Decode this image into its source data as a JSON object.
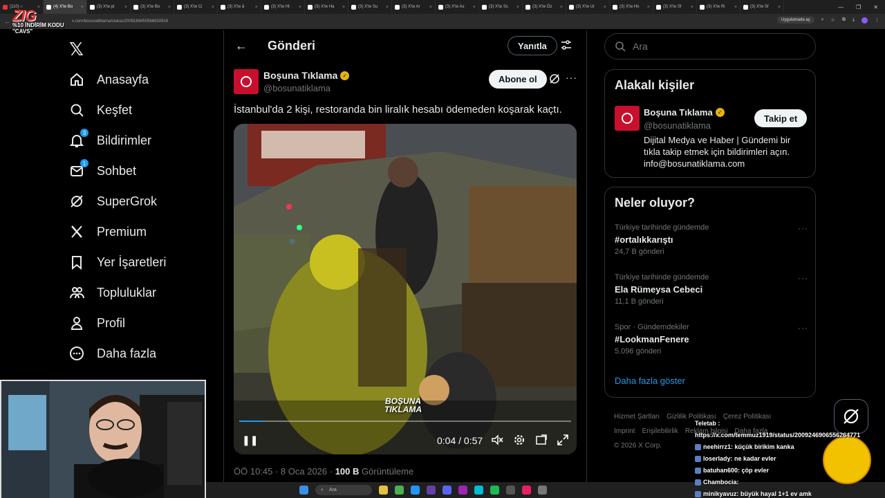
{
  "browser": {
    "tabs": [
      {
        "label": "(110) ○",
        "active": false
      },
      {
        "label": "(4) X'te Bo",
        "active": true
      },
      {
        "label": "(3) X'te pl",
        "active": false
      },
      {
        "label": "(3) X'te Bo",
        "active": false
      },
      {
        "label": "(3) X'te Ci",
        "active": false
      },
      {
        "label": "(3) X'te ã",
        "active": false
      },
      {
        "label": "(3) X'te Ht",
        "active": false
      },
      {
        "label": "(3) X'te Ha",
        "active": false
      },
      {
        "label": "(3) X'te Su",
        "active": false
      },
      {
        "label": "(3) X'te Ar",
        "active": false
      },
      {
        "label": "(3) X'te As",
        "active": false
      },
      {
        "label": "(3) X'te Sc",
        "active": false
      },
      {
        "label": "(3) X'te Öz",
        "active": false
      },
      {
        "label": "(3) X'te Ul",
        "active": false
      },
      {
        "label": "(3) X'te Ho",
        "active": false
      },
      {
        "label": "(3) X'te Sf",
        "active": false
      },
      {
        "label": "(3) X'te Ri",
        "active": false
      },
      {
        "label": "(3) X'te Sf",
        "active": false
      }
    ],
    "url": "x.com/bosunatiklama/status/2009169450566930916",
    "app_pill": "Uygulamada aç"
  },
  "overlay_logo": {
    "big": "ZIG",
    "small": "%10 İNDİRİM KODU \"CAVS\""
  },
  "leftnav": {
    "items": [
      {
        "name": "home",
        "label": "Anasayfa",
        "icon": "home-icon",
        "badge": ""
      },
      {
        "name": "explore",
        "label": "Keşfet",
        "icon": "search-icon",
        "badge": ""
      },
      {
        "name": "notifications",
        "label": "Bildirimler",
        "icon": "bell-icon",
        "badge": "3"
      },
      {
        "name": "messages",
        "label": "Sohbet",
        "icon": "mail-icon",
        "badge": "1"
      },
      {
        "name": "grok",
        "label": "SuperGrok",
        "icon": "grok-icon",
        "badge": ""
      },
      {
        "name": "premium",
        "label": "Premium",
        "icon": "x-icon",
        "badge": ""
      },
      {
        "name": "bookmarks",
        "label": "Yer İşaretleri",
        "icon": "bookmark-icon",
        "badge": ""
      },
      {
        "name": "communities",
        "label": "Topluluklar",
        "icon": "people-icon",
        "badge": ""
      },
      {
        "name": "profile",
        "label": "Profil",
        "icon": "person-icon",
        "badge": ""
      },
      {
        "name": "more",
        "label": "Daha fazla",
        "icon": "more-circle-icon",
        "badge": ""
      }
    ]
  },
  "post": {
    "header_title": "Gönderi",
    "reply_label": "Yanıtla",
    "author_name": "Boşuna Tıklama",
    "author_handle": "@bosunatiklama",
    "subscribe_label": "Abone ol",
    "text": "İstanbul'da 2 kişi, restoranda bin liralık hesabı ödemeden koşarak kaçtı.",
    "video": {
      "current_time": "0:04",
      "duration": "0:57",
      "time_display": "0:04 / 0:57",
      "progress": 0.07,
      "watermark_line1": "BOŞUNA",
      "watermark_line2": "TIKLAMA"
    },
    "time": "ÖÖ 10:45 · 8 Oca 2026 · ",
    "views": "100 B",
    "views_label": " Görüntüleme"
  },
  "right": {
    "search_placeholder": "Ara",
    "related_title": "Alakalı kişiler",
    "related": {
      "name": "Boşuna Tıklama",
      "handle": "@bosunatiklama",
      "bio": "Dijital Medya ve Haber | Gündemi bir tıkla takip etmek için bildirimleri açın. info@bosunatiklama.com",
      "follow_label": "Takip et"
    },
    "trends_title": "Neler oluyor?",
    "trends": [
      {
        "meta": "Türkiye tarihinde gündemde",
        "name": "#ortalıkkarıştı",
        "count": "24,7 B gönderi"
      },
      {
        "meta": "Türkiye tarihinde gündemde",
        "name": "Ela Rümeysa Cebeci",
        "count": "11,1 B gönderi"
      },
      {
        "meta": "Spor · Gündemdekiler",
        "name": "#LookmanFenere",
        "count": "5.096 gönderi"
      }
    ],
    "show_more": "Daha fazla göster",
    "footer": [
      "Hizmet Şartları",
      "Gizlilik Politikası",
      "Çerez Politikası",
      "Imprint",
      "Erişilebilirlik",
      "Reklam bilgisi",
      "Daha fazla",
      "© 2026 X Corp."
    ]
  },
  "chat": [
    {
      "user": "Teletab",
      "text": " :"
    },
    {
      "user": "",
      "text": "https://x.com/temmuz1919/status/2009246906556264771"
    },
    {
      "user": "neehirrz1",
      "text": ": küçük birikim kanka"
    },
    {
      "user": "loserlady",
      "text": ": ne kadar evler"
    },
    {
      "user": "batuhan600",
      "text": ": çöp evler"
    },
    {
      "user": "Chambocia",
      "text": ":"
    },
    {
      "user": "minikyavuz",
      "text": ": büyük hayal 1+1 ev amk"
    }
  ],
  "taskbar": {
    "search_label": "Ara"
  },
  "colors": {
    "accent": "#1d9bf0",
    "verified": "#e8b40c",
    "brand_red": "#c8102e",
    "border": "#2f3336",
    "muted": "#71767b"
  }
}
